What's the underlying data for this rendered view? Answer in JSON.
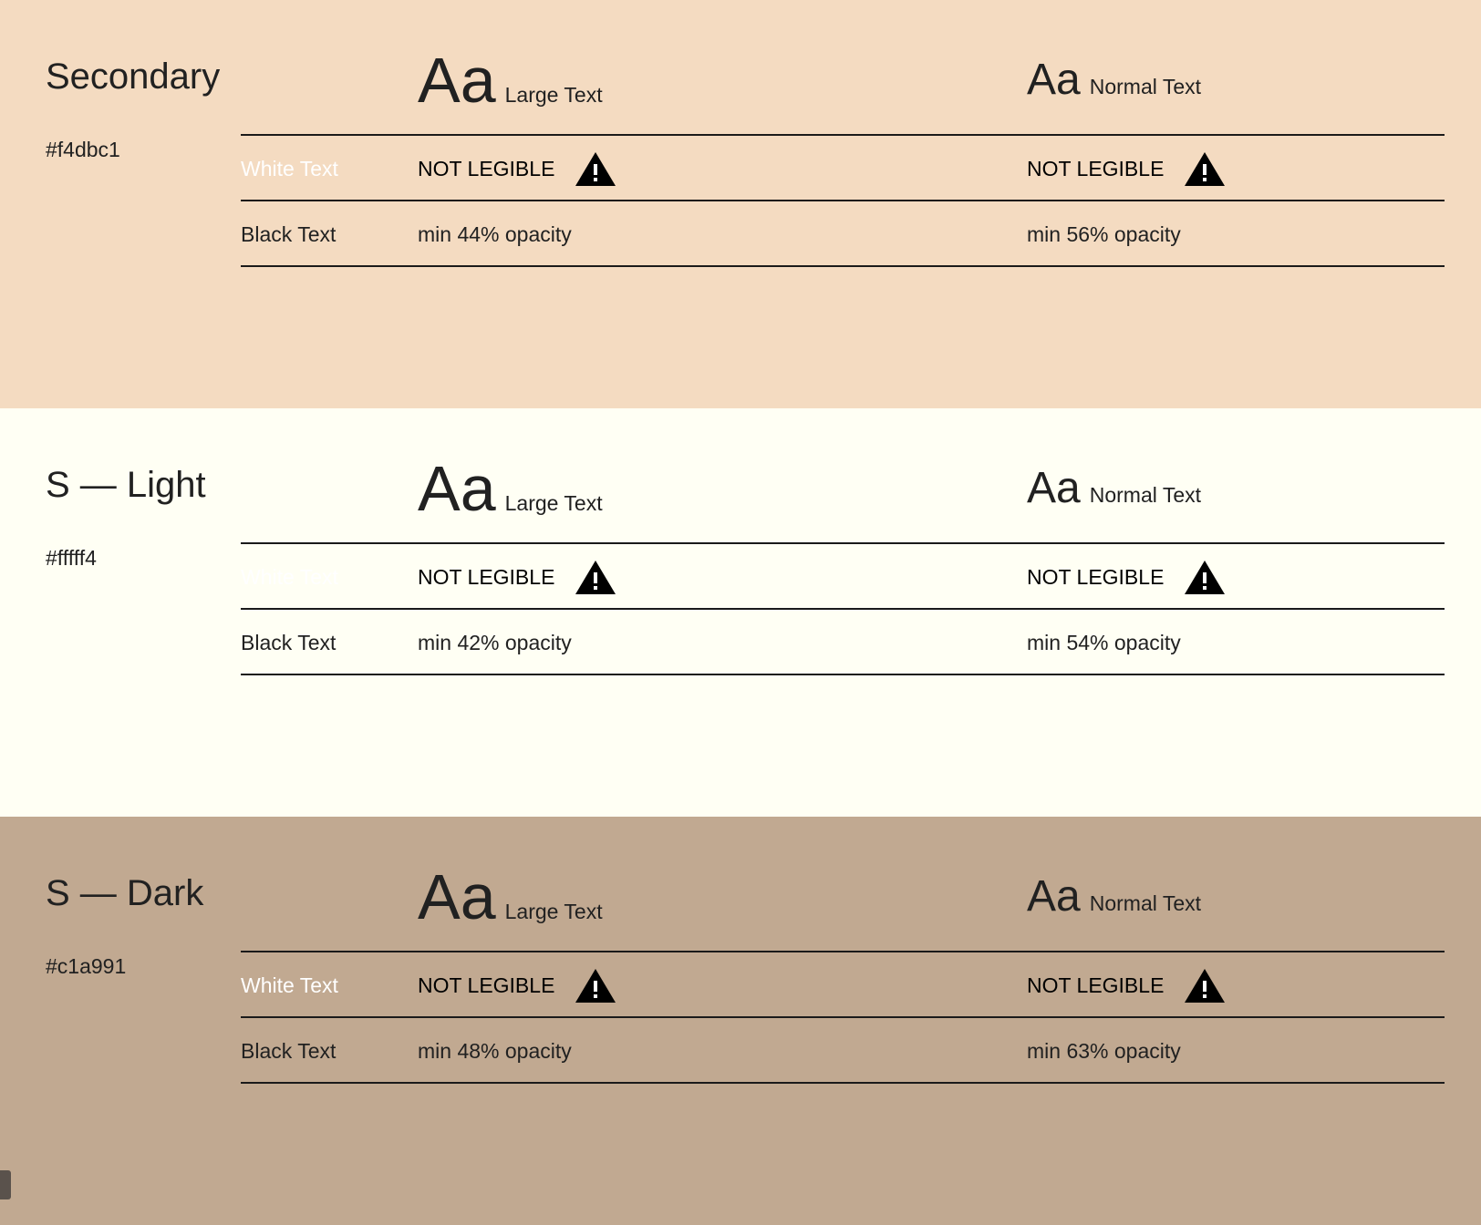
{
  "column_headers": {
    "large": {
      "aa": "Aa",
      "label": "Large Text"
    },
    "normal": {
      "aa": "Aa",
      "label": "Normal Text"
    }
  },
  "sections": [
    {
      "name": "Secondary",
      "hex": "#f4dbc1",
      "background": "#f4dbc1",
      "white_row": {
        "label": "White Text",
        "large": "NOT LEGIBLE",
        "normal": "NOT LEGIBLE"
      },
      "black_row": {
        "label": "Black Text",
        "large": "min 44% opacity",
        "normal": "min 56% opacity"
      }
    },
    {
      "name": "S — Light",
      "hex": "#fffff4",
      "background": "#fffff4",
      "white_row": {
        "label": "White Text",
        "large": "NOT LEGIBLE",
        "normal": "NOT LEGIBLE"
      },
      "black_row": {
        "label": "Black Text",
        "large": "min 42% opacity",
        "normal": "min 54% opacity"
      }
    },
    {
      "name": "S — Dark",
      "hex": "#c1a991",
      "background": "#c1a991",
      "white_row": {
        "label": "White Text",
        "large": "NOT LEGIBLE",
        "normal": "NOT LEGIBLE"
      },
      "black_row": {
        "label": "Black Text",
        "large": "min 48% opacity",
        "normal": "min 63% opacity"
      }
    }
  ],
  "icons": {
    "warning": "warning-icon"
  }
}
